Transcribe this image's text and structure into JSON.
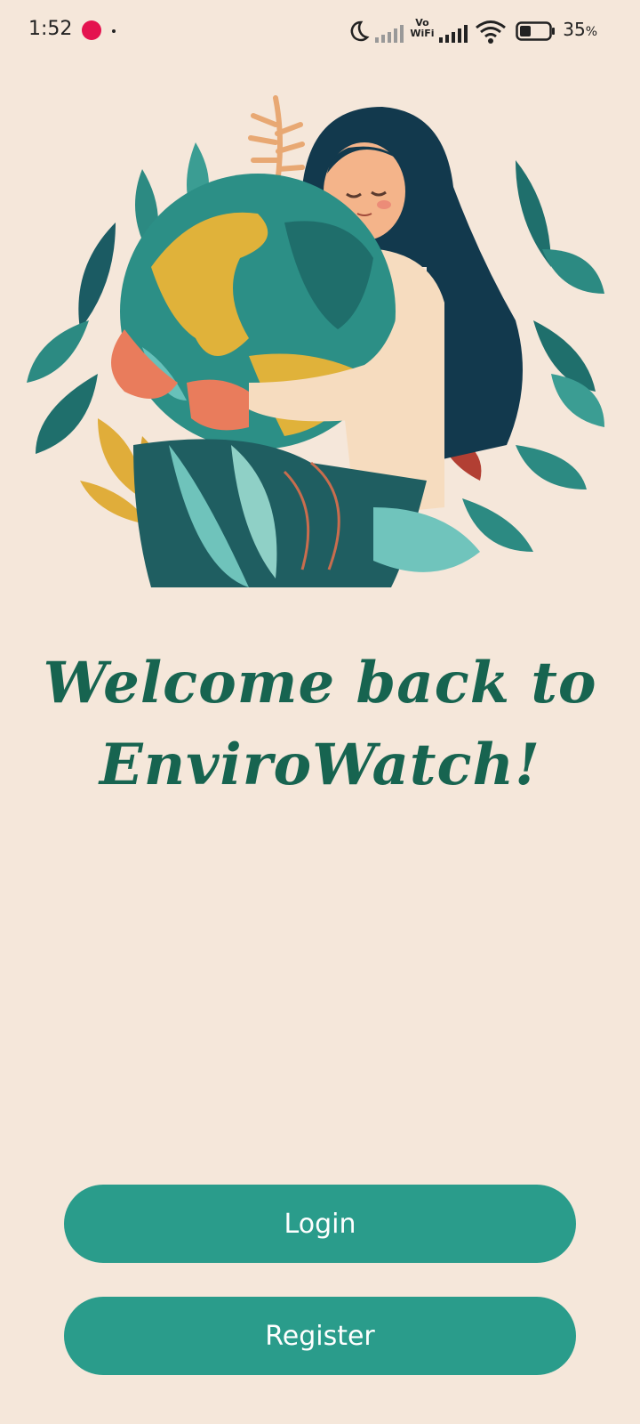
{
  "status_bar": {
    "time": "1:52",
    "battery_percent": "35",
    "battery_suffix": "%",
    "vowifi_top": "Vo",
    "vowifi_bottom": "WiFi"
  },
  "hero": {
    "icon": "woman-hugging-earth-illustration"
  },
  "welcome": {
    "line1": "Welcome back to",
    "line2": "EnviroWatch!"
  },
  "buttons": {
    "login": "Login",
    "register": "Register"
  },
  "colors": {
    "background": "#f5e7da",
    "title": "#176450",
    "button": "#2a9c8b"
  }
}
